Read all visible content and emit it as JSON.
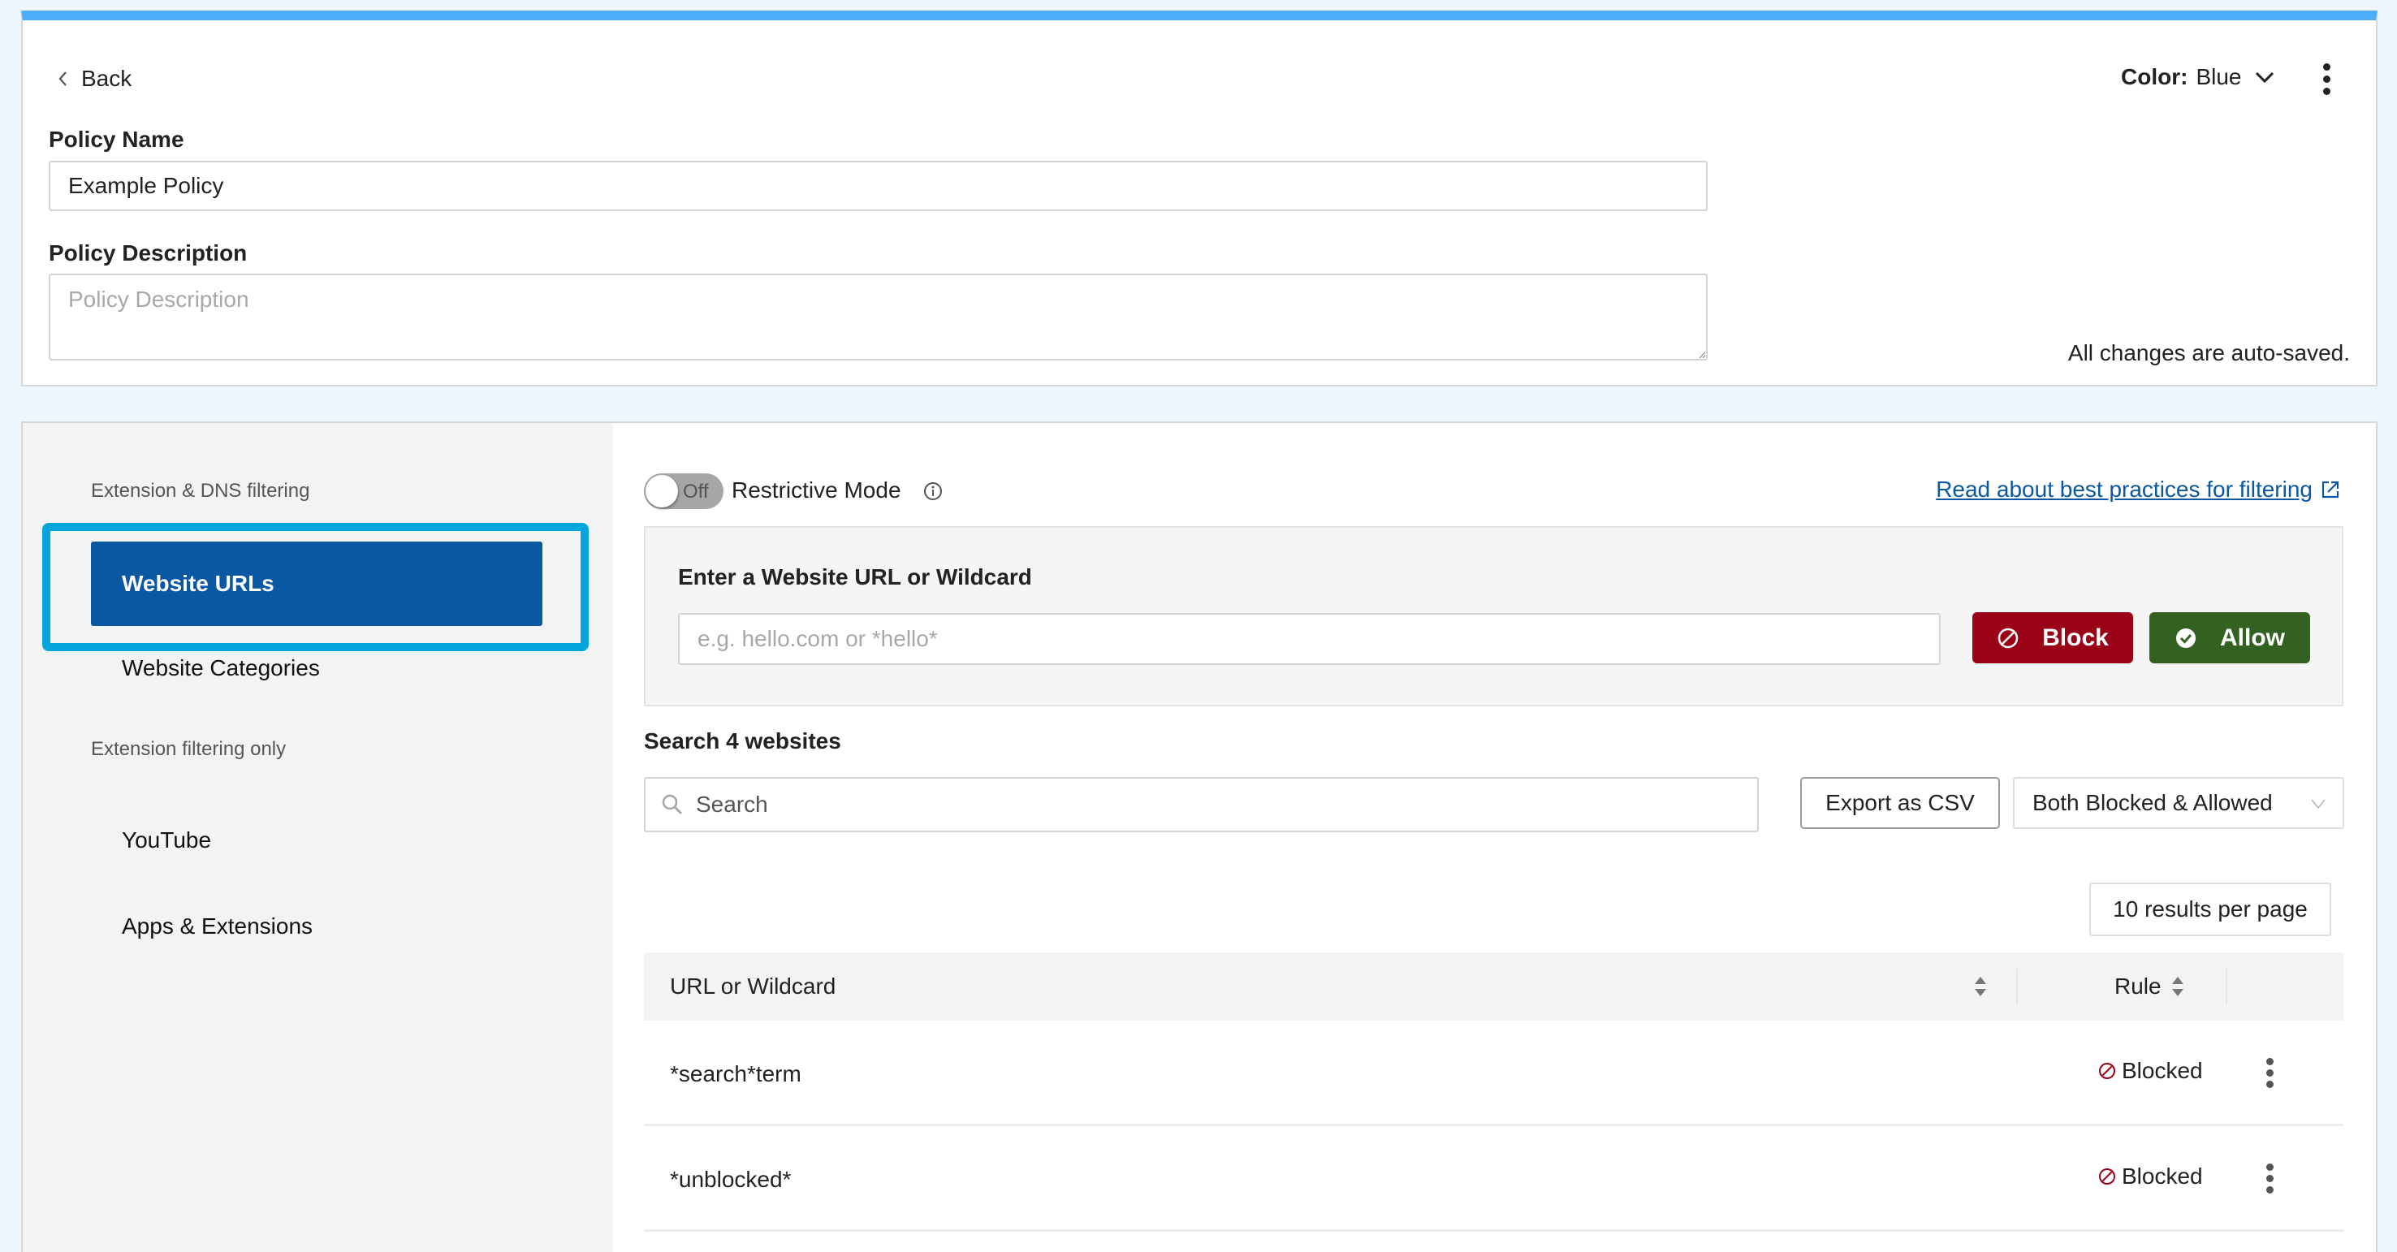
{
  "header": {
    "back_label": "Back",
    "color_label": "Color:",
    "color_value": "Blue",
    "autosave_text": "All changes are auto-saved."
  },
  "form": {
    "policy_name_label": "Policy Name",
    "policy_name_value": "Example Policy",
    "policy_description_label": "Policy Description",
    "policy_description_value": "",
    "policy_description_placeholder": "Policy Description"
  },
  "sidebar": {
    "sections": [
      {
        "heading": "Extension & DNS filtering",
        "items": [
          {
            "label": "Website URLs",
            "selected": true
          },
          {
            "label": "Website Categories",
            "selected": false
          }
        ]
      },
      {
        "heading": "Extension filtering only",
        "items": [
          {
            "label": "YouTube",
            "selected": false
          },
          {
            "label": "Apps & Extensions",
            "selected": false
          }
        ]
      }
    ]
  },
  "main": {
    "restrictive_mode": {
      "label": "Restrictive Mode",
      "state": "Off"
    },
    "best_practices_link": "Read about best practices for filtering",
    "add_panel": {
      "label": "Enter a Website URL or Wildcard",
      "placeholder": "e.g. hello.com or *hello*",
      "value": "",
      "block_label": "Block",
      "allow_label": "Allow"
    },
    "search": {
      "heading": "Search 4 websites",
      "placeholder": "Search",
      "value": ""
    },
    "export_label": "Export as CSV",
    "filter_selected": "Both Blocked & Allowed",
    "per_page_label": "10 results per page",
    "table": {
      "columns": [
        "URL or Wildcard",
        "Rule"
      ],
      "rows": [
        {
          "url": "*search*term",
          "rule": "Blocked"
        },
        {
          "url": "*unblocked*",
          "rule": "Blocked"
        }
      ]
    }
  },
  "colors": {
    "accent_bar": "#4eaefc",
    "selected_nav": "#0a58a3",
    "highlight_outline": "#04a4dc",
    "block": "#9a0217",
    "allow": "#326122",
    "link": "#0a58a3",
    "blocked_icon": "#9a0217"
  }
}
